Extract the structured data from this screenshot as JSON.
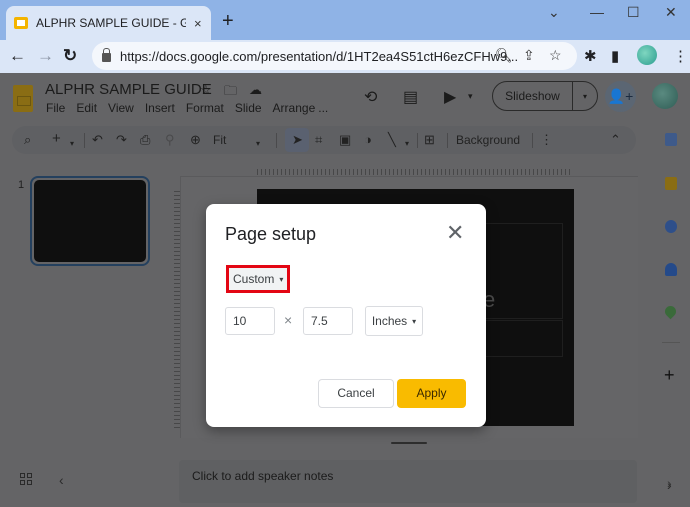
{
  "browser": {
    "tab_title": "ALPHR SAMPLE GUIDE - Google",
    "tab_close": "×",
    "new_tab": "+",
    "url": "https://docs.google.com/presentation/d/1HT2ea4S51ctH6ezCFHw9...",
    "window_controls": {
      "dropdown": "⌄",
      "minimize": "—",
      "maximize": "☐",
      "close": "✕"
    },
    "nav": {
      "back": "←",
      "forward": "→",
      "reload": "↻"
    },
    "icons": {
      "zoom": "🔍︎",
      "share": "⇪",
      "bookmark": "☆",
      "extensions": "✱",
      "sidepanel": "▮",
      "menu": "⋮"
    }
  },
  "app": {
    "doc_title": "ALPHR SAMPLE GUIDE",
    "title_icons": {
      "star": "☆",
      "move": "🗀",
      "cloud": "☁"
    },
    "menu": [
      "File",
      "Edit",
      "View",
      "Insert",
      "Format",
      "Slide",
      "Arrange",
      "..."
    ],
    "header_icons": {
      "history": "⟲",
      "comments": "▤",
      "meet": "▶",
      "meet_caret": "▾"
    },
    "slideshow_label": "Slideshow",
    "slideshow_caret": "▾",
    "share_icon": "👤+",
    "toolbar": {
      "search": "⌕",
      "add": "+",
      "add_caret": "▾",
      "undo": "↶",
      "redo": "↷",
      "print": "⎙",
      "paint": "⚲",
      "zoom": "⊕",
      "zoom_value": "Fit",
      "zoom_caret": "▾",
      "select": "➤",
      "textbox": "⌗",
      "image": "▣",
      "shape": "◑",
      "line": "╲",
      "line_caret": "▾",
      "comment": "⊞",
      "background_label": "Background",
      "more": "⋮",
      "collapse": "⌃"
    },
    "right_panel": {
      "add": "+",
      "expand": "›",
      "colors": {
        "calendar": "#3e5a8a",
        "keep": "#8a6d14",
        "tasks": "#2e4f8a",
        "contacts": "#244a8a",
        "maps": "#3a6a3a"
      }
    },
    "filmstrip": {
      "slide_number": "1"
    },
    "slide_text_fragment": "e",
    "notes_placeholder": "Click to add speaker notes",
    "bottom": {
      "prev": "‹",
      "next": "›"
    }
  },
  "dialog": {
    "title": "Page setup",
    "close": "✕",
    "preset_value": "Custom",
    "preset_caret": "▾",
    "width_value": "10",
    "times": "×",
    "height_value": "7.5",
    "unit_value": "Inches",
    "unit_caret": "▾",
    "cancel_label": "Cancel",
    "apply_label": "Apply",
    "colors": {
      "apply_bg": "#f9bb00",
      "highlight": "#e30613"
    }
  }
}
